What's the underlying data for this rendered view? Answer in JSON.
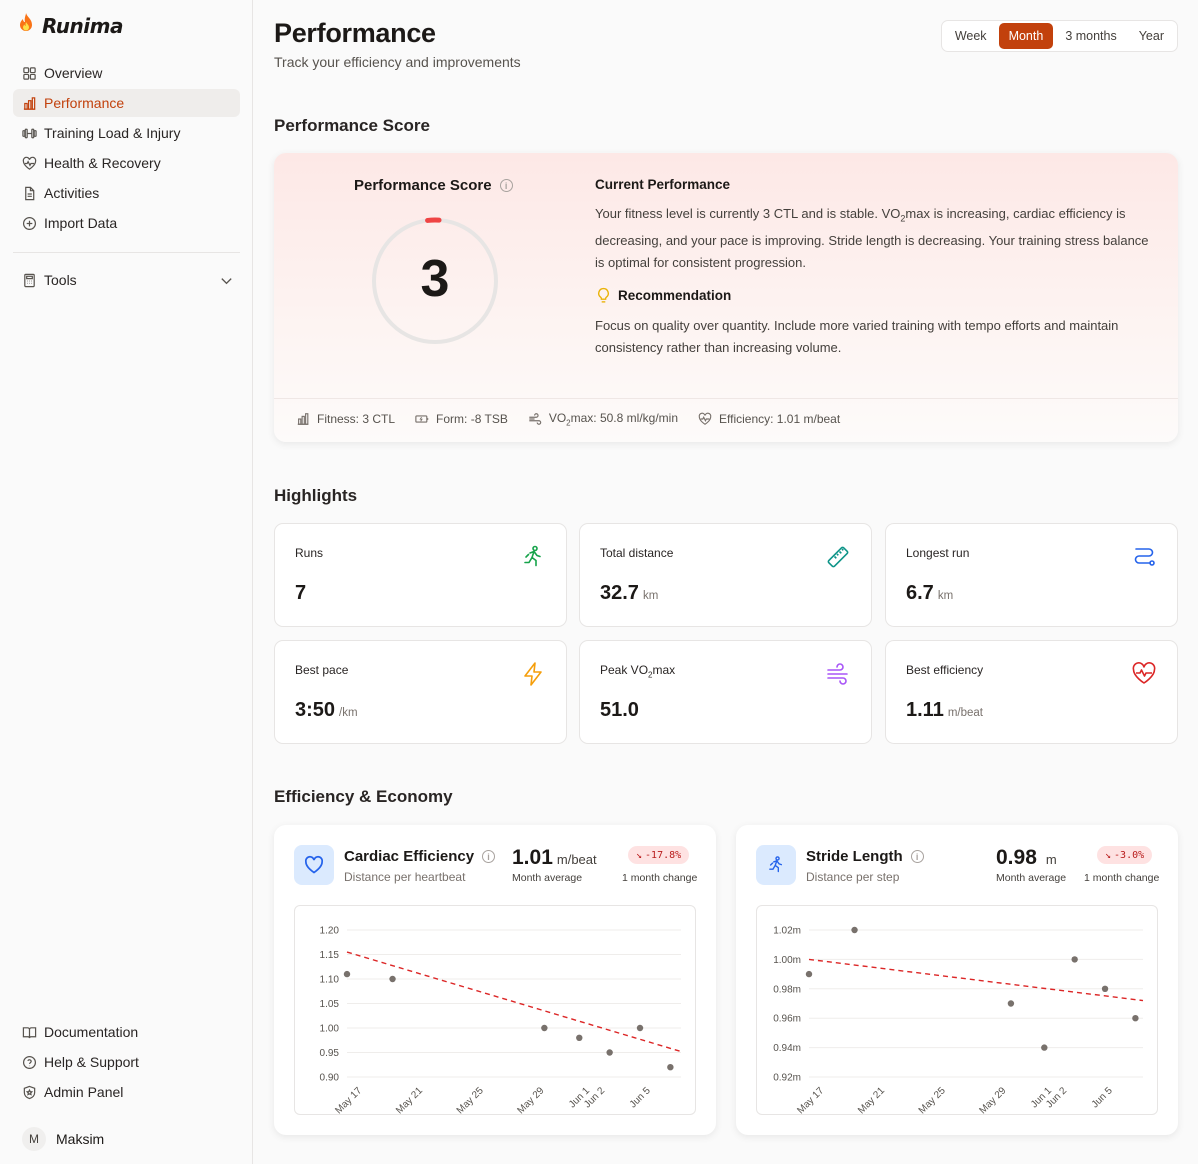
{
  "brand": {
    "name": "Runima",
    "logo_icon": "flame-icon"
  },
  "nav": {
    "items": [
      {
        "label": "Overview",
        "icon": "grid-icon"
      },
      {
        "label": "Performance",
        "icon": "bar-chart-icon",
        "active": true
      },
      {
        "label": "Training Load & Injury",
        "icon": "dumbbell-icon"
      },
      {
        "label": "Health & Recovery",
        "icon": "heart-pulse-icon"
      },
      {
        "label": "Activities",
        "icon": "file-icon"
      },
      {
        "label": "Import Data",
        "icon": "plus-circle-icon"
      }
    ],
    "tools_label": "Tools",
    "bottom": [
      {
        "label": "Documentation",
        "icon": "book-icon"
      },
      {
        "label": "Help & Support",
        "icon": "help-circle-icon"
      },
      {
        "label": "Admin Panel",
        "icon": "shield-icon"
      }
    ],
    "user": {
      "initial": "M",
      "name": "Maksim"
    }
  },
  "header": {
    "title": "Performance",
    "subtitle": "Track your efficiency and improvements",
    "ranges": [
      "Week",
      "Month",
      "3 months",
      "Year"
    ],
    "active_range": "Month"
  },
  "performance": {
    "section_title": "Performance Score",
    "card_title": "Performance Score",
    "score": "3",
    "score_fraction": 0.03,
    "current_title": "Current Performance",
    "current_text_pre": "Your fitness level is currently 3 CTL and is stable. VO",
    "current_text_sub": "2",
    "current_text_post": "max is increasing, cardiac efficiency is decreasing, and your pace is improving. Stride length is decreasing. Your training stress balance is optimal for consistent progression.",
    "rec_title": "Recommendation",
    "rec_text": "Focus on quality over quantity. Include more varied training with tempo efforts and maintain consistency rather than increasing volume.",
    "stats": {
      "fitness": "Fitness: 3 CTL",
      "form": "Form: -8 TSB",
      "vo2_pre": "VO",
      "vo2_sub": "2",
      "vo2_post": "max: 50.8 ml/kg/min",
      "efficiency": "Efficiency: 1.01 m/beat"
    }
  },
  "highlights": {
    "section_title": "Highlights",
    "runs": {
      "label": "Runs",
      "value": "7",
      "unit": ""
    },
    "total_distance": {
      "label": "Total distance",
      "value": "32.7",
      "unit": "km"
    },
    "longest_run": {
      "label": "Longest run",
      "value": "6.7",
      "unit": "km"
    },
    "best_pace": {
      "label": "Best pace",
      "value": "3:50",
      "unit": "/km"
    },
    "peak_vo2": {
      "label_pre": "Peak VO",
      "label_sub": "2",
      "label_post": "max",
      "value": "51.0",
      "unit": ""
    },
    "best_efficiency": {
      "label": "Best efficiency",
      "value": "1.11",
      "unit": "m/beat"
    }
  },
  "efficiency": {
    "section_title": "Efficiency & Economy",
    "cardiac": {
      "title": "Cardiac Efficiency",
      "subtitle": "Distance per heartbeat",
      "avg": "1.01",
      "avg_unit": "m/beat",
      "avg_label": "Month average",
      "change": "-17.8%",
      "change_label": "1 month change"
    },
    "stride": {
      "title": "Stride Length",
      "subtitle": "Distance per step",
      "avg": "0.98",
      "avg_unit": "m",
      "avg_label": "Month average",
      "change": "-3.0%",
      "change_label": "1 month change"
    }
  },
  "colors": {
    "accent": "#c2410c",
    "trend": "#dc2626",
    "point": "#78716c"
  },
  "chart_data": [
    {
      "type": "scatter",
      "title": "",
      "ylim": [
        0.9,
        1.2
      ],
      "yticks": [
        "1.20",
        "1.15",
        "1.10",
        "1.05",
        "1.00",
        "0.95",
        "0.90"
      ],
      "ytick_values": [
        1.2,
        1.15,
        1.1,
        1.05,
        1.0,
        0.95,
        0.9
      ],
      "xticks": [
        "May 17",
        "May 21",
        "May 25",
        "May 29",
        "Jun 1",
        "Jun 2",
        "Jun 5"
      ],
      "xtick_days": [
        17,
        21,
        25,
        29,
        32,
        33,
        36
      ],
      "x_range_days": [
        16,
        38
      ],
      "points": [
        {
          "day": 16,
          "value": 1.11
        },
        {
          "day": 19,
          "value": 1.1
        },
        {
          "day": 29,
          "value": 1.0
        },
        {
          "day": 31.3,
          "value": 0.98
        },
        {
          "day": 33.3,
          "value": 0.95
        },
        {
          "day": 35.3,
          "value": 1.0
        },
        {
          "day": 37.3,
          "value": 0.92
        }
      ],
      "trendline": {
        "start": 1.155,
        "end": 0.952
      }
    },
    {
      "type": "scatter",
      "title": "",
      "ylim": [
        0.92,
        1.02
      ],
      "yticks": [
        "1.02m",
        "1.00m",
        "0.98m",
        "0.96m",
        "0.94m",
        "0.92m"
      ],
      "ytick_values": [
        1.02,
        1.0,
        0.98,
        0.96,
        0.94,
        0.92
      ],
      "xticks": [
        "May 17",
        "May 21",
        "May 25",
        "May 29",
        "Jun 1",
        "Jun 2",
        "Jun 5"
      ],
      "xtick_days": [
        17,
        21,
        25,
        29,
        32,
        33,
        36
      ],
      "x_range_days": [
        16,
        38
      ],
      "points": [
        {
          "day": 16,
          "value": 0.99
        },
        {
          "day": 19,
          "value": 1.02
        },
        {
          "day": 29.3,
          "value": 0.97
        },
        {
          "day": 31.5,
          "value": 0.94
        },
        {
          "day": 33.5,
          "value": 1.0
        },
        {
          "day": 35.5,
          "value": 0.98
        },
        {
          "day": 37.5,
          "value": 0.96
        }
      ],
      "trendline": {
        "start": 1.0,
        "end": 0.972
      }
    }
  ]
}
